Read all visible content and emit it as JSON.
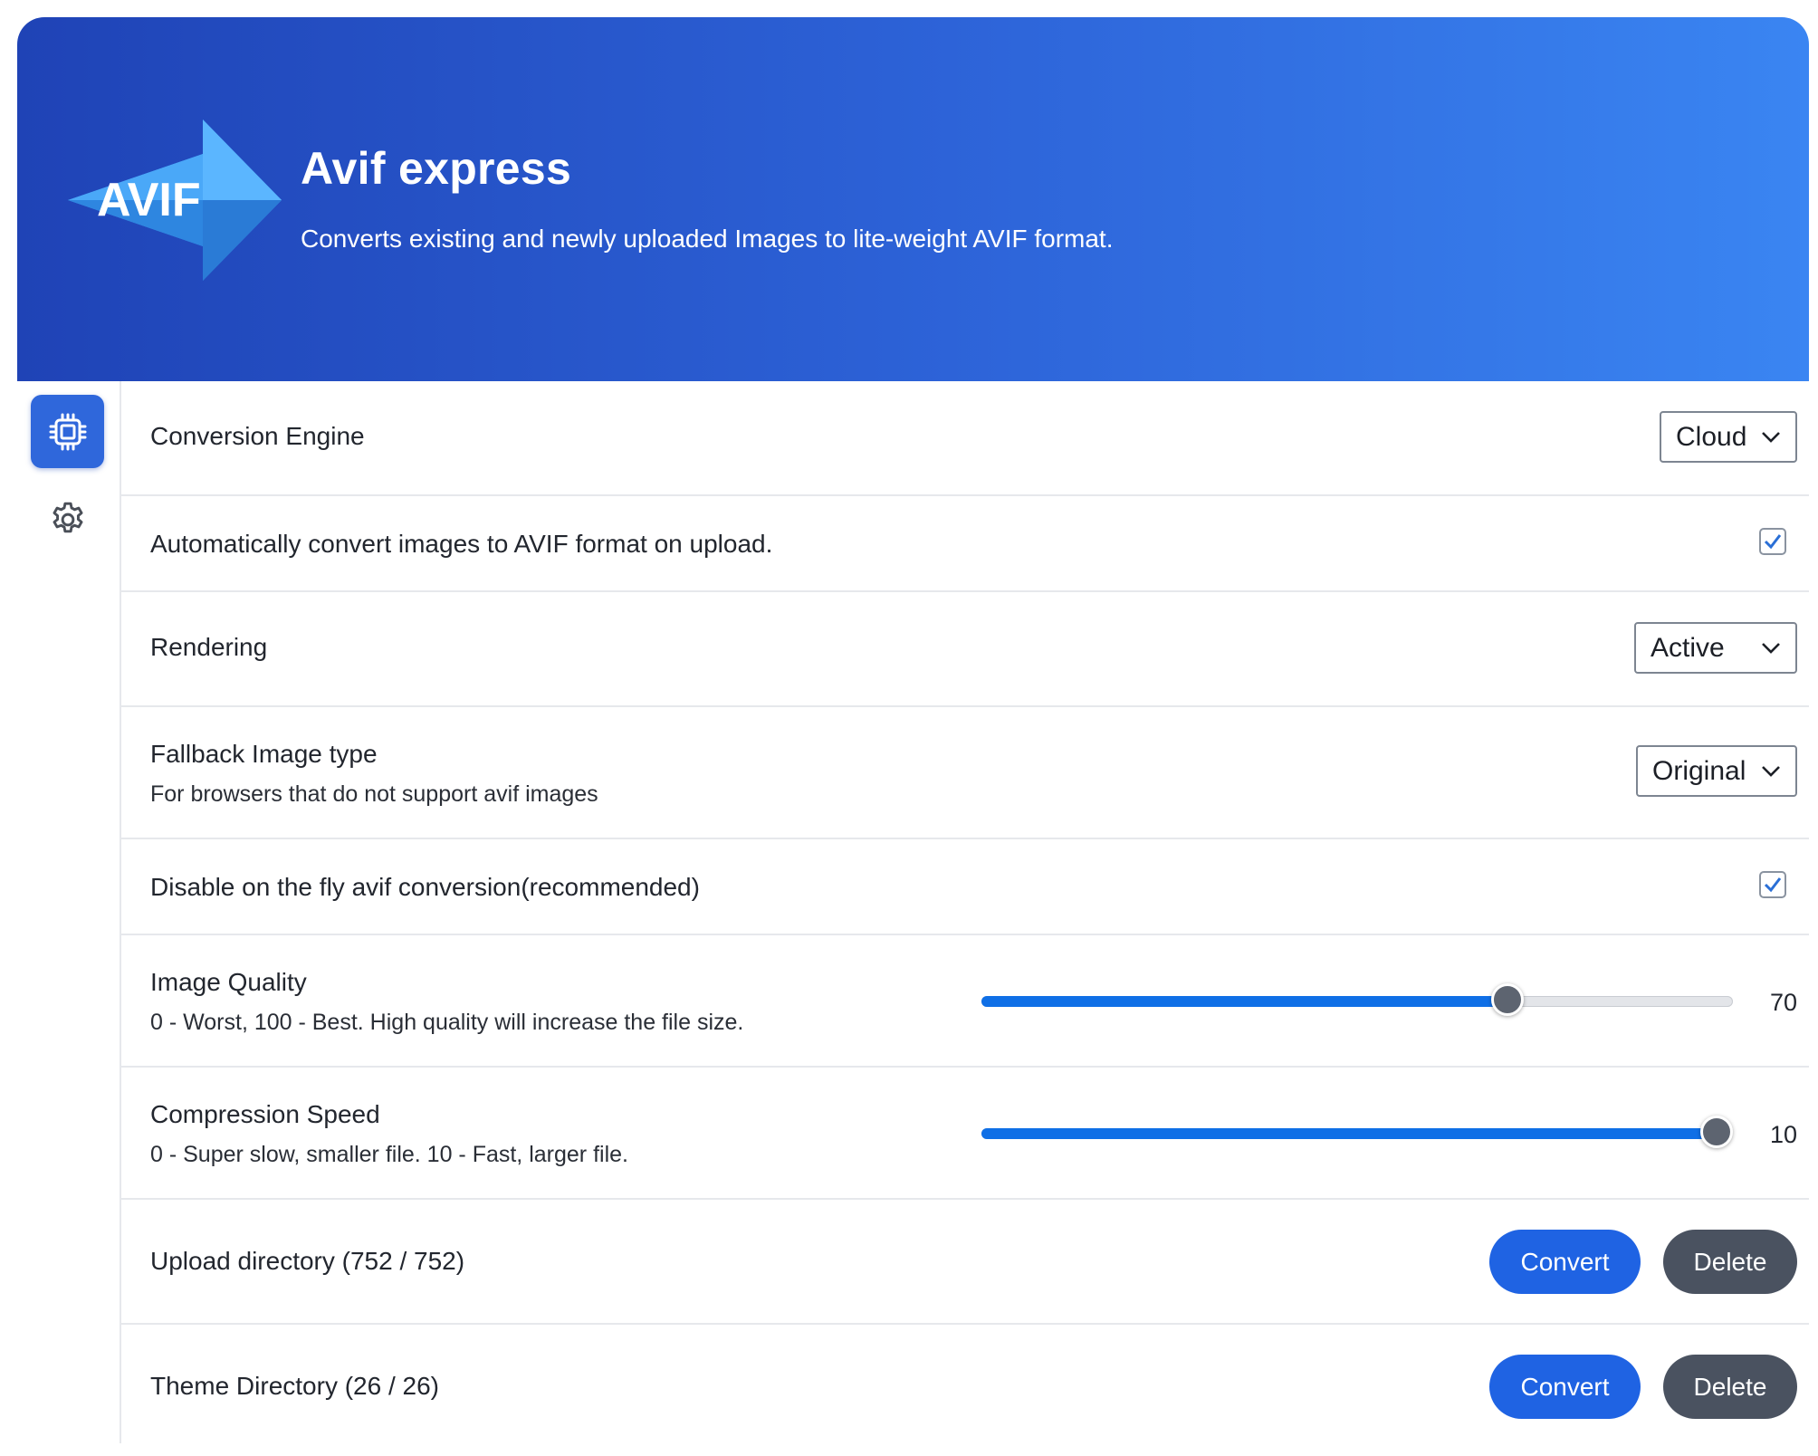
{
  "header": {
    "title": "Avif express",
    "subtitle": "Converts existing and newly uploaded Images to lite-weight AVIF format.",
    "logo_text": "AVIF"
  },
  "sidebar": {
    "items": [
      {
        "icon": "cpu-chip-icon",
        "active": true
      },
      {
        "icon": "gear-icon",
        "active": false
      }
    ]
  },
  "settings": {
    "conversion_engine": {
      "label": "Conversion Engine",
      "value": "Cloud"
    },
    "auto_convert": {
      "label": "Automatically convert images to AVIF format on upload.",
      "checked": true
    },
    "rendering": {
      "label": "Rendering",
      "value": "Active"
    },
    "fallback": {
      "label": "Fallback Image type",
      "description": "For browsers that do not support avif images",
      "value": "Original"
    },
    "disable_on_fly": {
      "label": "Disable on the fly avif conversion(recommended)",
      "checked": true
    },
    "image_quality": {
      "label": "Image Quality",
      "description": "0 - Worst, 100 - Best. High quality will increase the file size.",
      "value": "70",
      "min": 0,
      "max": 100
    },
    "compression_speed": {
      "label": "Compression Speed",
      "description": "0 - Super slow, smaller file. 10 - Fast, larger file.",
      "value": "10",
      "min": 0,
      "max": 10
    },
    "upload_directory": {
      "label": "Upload directory (752 / 752)",
      "convert_label": "Convert",
      "delete_label": "Delete"
    },
    "theme_directory": {
      "label": "Theme Directory (26 / 26)",
      "convert_label": "Convert",
      "delete_label": "Delete"
    }
  },
  "colors": {
    "accent": "#1f63e3",
    "banner_start": "#1f43b6",
    "banner_end": "#3a85f2",
    "delete_button": "#4a5260"
  }
}
